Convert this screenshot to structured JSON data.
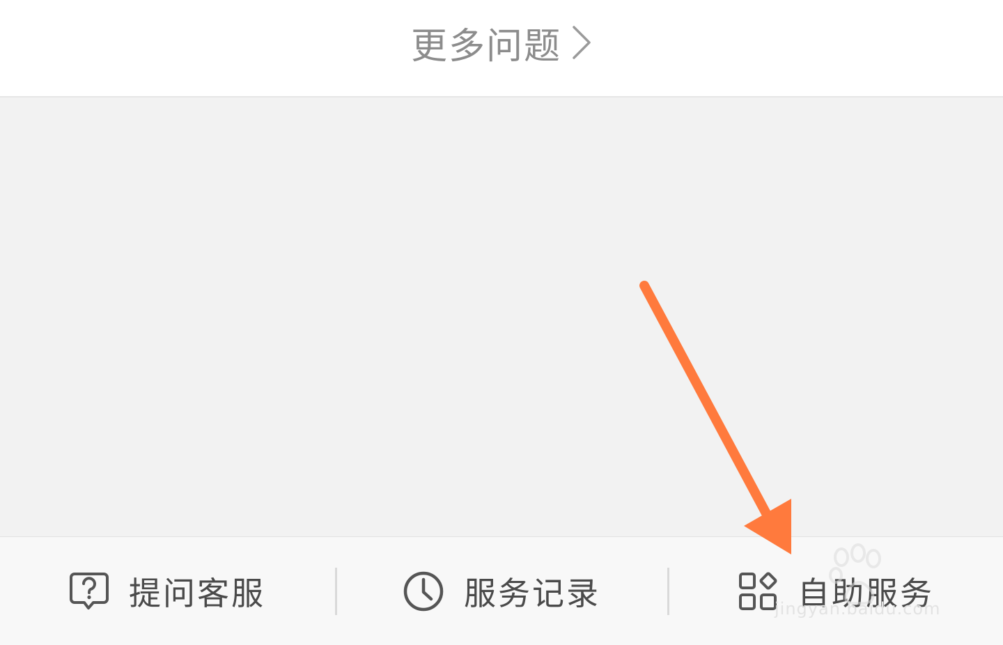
{
  "header": {
    "more_label": "更多问题",
    "chevron_icon": "chevron-right-icon"
  },
  "toolbar": {
    "items": [
      {
        "label": "提问客服",
        "icon": "question-bubble-icon"
      },
      {
        "label": "服务记录",
        "icon": "clock-icon"
      },
      {
        "label": "自助服务",
        "icon": "grid-apps-icon"
      }
    ]
  },
  "watermark": {
    "url_text": "jingyan.baidu.com"
  },
  "colors": {
    "arrow": "#ff7a3d",
    "label": "#4a4a4a",
    "header_label": "#8c8c8c",
    "content_bg": "#f2f2f2"
  }
}
